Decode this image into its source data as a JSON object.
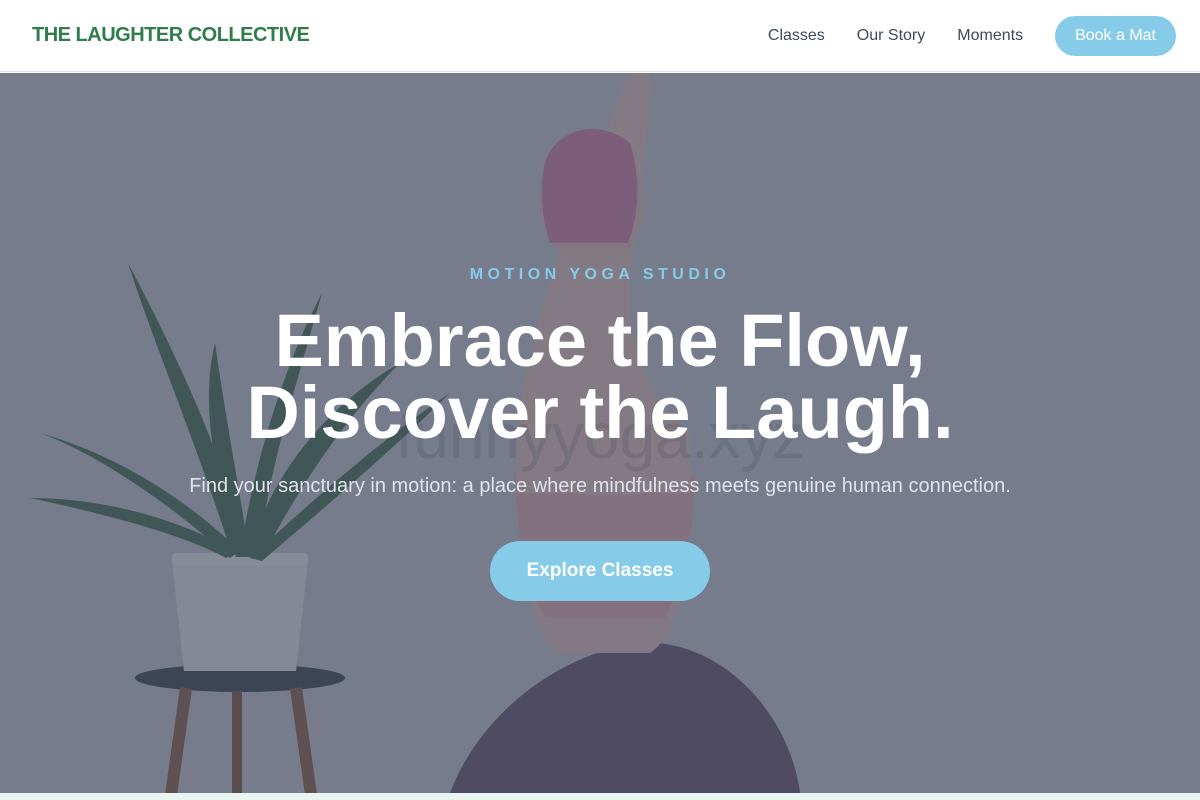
{
  "navbar": {
    "brand": "THE LAUGHTER COLLECTIVE",
    "links": [
      {
        "label": "Classes"
      },
      {
        "label": "Our Story"
      },
      {
        "label": "Moments"
      }
    ],
    "cta_label": "Book a Mat"
  },
  "hero": {
    "eyebrow": "MOTION YOGA STUDIO",
    "headline_line1": "Embrace the Flow,",
    "headline_line2": "Discover the Laugh.",
    "subtext": "Find your sanctuary in motion: a place where mindfulness meets genuine human connection.",
    "cta_label": "Explore Classes",
    "background_image": "yoga-photo"
  },
  "colors": {
    "brand": "#2f7d4a",
    "accent": "#86cbe8",
    "nav_text": "#3e4a5a",
    "overlay": "rgba(70,76,96,0.62)"
  }
}
